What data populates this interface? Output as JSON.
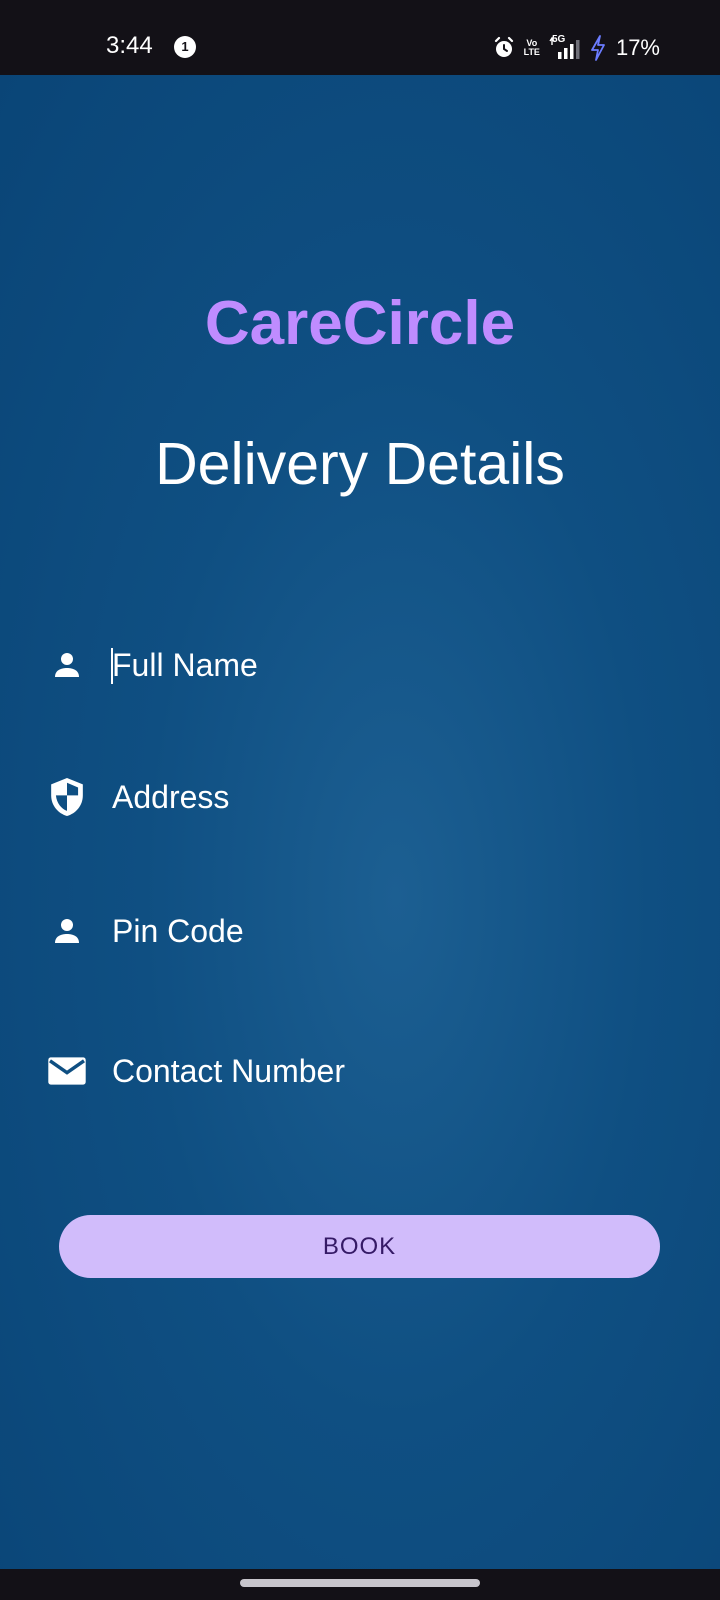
{
  "status_bar": {
    "time": "3:44",
    "notification_count": "1",
    "volte_top": "Vo",
    "volte_bottom": "LTE",
    "network": "5G",
    "battery": "17%",
    "icons": [
      "alarm-icon",
      "volte-icon",
      "signal-icon",
      "charging-icon"
    ]
  },
  "app": {
    "brand": "CareCircle",
    "title": "Delivery Details",
    "brand_color": "#bf8cff",
    "background_color": "#0f4f82"
  },
  "form": {
    "fields": [
      {
        "label": "Full Name",
        "icon": "person-icon"
      },
      {
        "label": "Address",
        "icon": "shield-icon"
      },
      {
        "label": "Pin Code",
        "icon": "person-icon"
      },
      {
        "label": "Contact Number",
        "icon": "mail-icon"
      }
    ],
    "submit_label": "BOOK",
    "submit_color": "#d1bcfb"
  }
}
